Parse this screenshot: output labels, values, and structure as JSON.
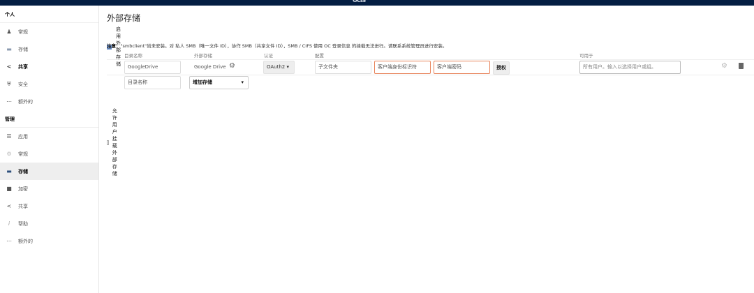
{
  "header": {
    "logo": "ocis"
  },
  "sidebar": {
    "personal_title": "个人",
    "personal": [
      {
        "icon": "user-icon",
        "label": "常规"
      },
      {
        "icon": "folder-icon",
        "label": "存储"
      },
      {
        "icon": "share-icon",
        "label": "共享"
      },
      {
        "icon": "shield-icon",
        "label": "安全"
      },
      {
        "icon": "more-icon",
        "label": "额外的"
      }
    ],
    "admin_title": "管理",
    "admin": [
      {
        "icon": "menu-icon",
        "label": "应用"
      },
      {
        "icon": "gear-icon",
        "label": "常规"
      },
      {
        "icon": "folder-icon",
        "label": "存储"
      },
      {
        "icon": "lock-icon",
        "label": "加密"
      },
      {
        "icon": "share-icon",
        "label": "共享"
      },
      {
        "icon": "info-icon",
        "label": "帮助"
      },
      {
        "icon": "more-icon",
        "label": "额外的"
      }
    ]
  },
  "main": {
    "title": "外部存储",
    "enable_label": "启用外部存储",
    "note_bold": "注意：",
    "note": "\"smbclient\"尚未安装。对 私人 SMB（唯一文件 ID），协作 SMB（共享文件 ID），SMB / CIFS 使用 OC 登录信息 的挂载无法进行。请联系系统管理员进行安装。",
    "headers": {
      "folder": "目录名称",
      "storage": "外部存储",
      "auth": "认证",
      "config": "配置",
      "available": "可用于"
    },
    "row": {
      "folder": "GoogleDrive",
      "storage": "Google Drive",
      "auth": "OAuth2",
      "subfolder": "子文件夹",
      "client_id_placeholder": "客户端身份标识符",
      "client_secret_placeholder": "客户端密码",
      "grant_button": "授权",
      "available_placeholder": "所有用户。输入以选择用户或组。"
    },
    "new_row": {
      "folder_placeholder": "目录名称",
      "add_storage": "增加存储"
    },
    "allow_user_label": "允许用户挂载外部存储"
  }
}
